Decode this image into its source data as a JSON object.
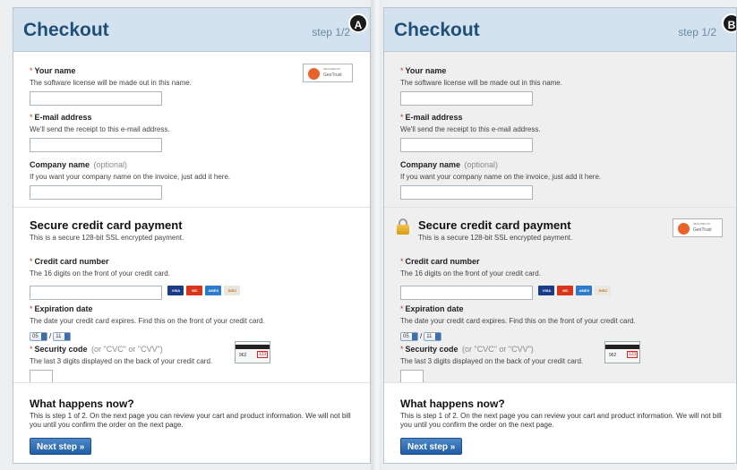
{
  "variants": [
    {
      "badge": "A",
      "header": {
        "title": "Checkout",
        "step": "step 1/2"
      },
      "name": {
        "label": "Your name",
        "hint": "The software license will be made out in this name."
      },
      "email": {
        "label": "E-mail address",
        "hint": "We'll send the receipt to this e-mail address."
      },
      "company": {
        "label": "Company name",
        "optional": "(optional)",
        "hint": "If you want your company name on the invoice, just add it here."
      },
      "payment": {
        "title": "Secure credit card payment",
        "subtitle": "This is a secure 128-bit SSL encrypted payment."
      },
      "cc": {
        "label": "Credit card number",
        "hint": "The 16 digits on the front of your credit card."
      },
      "expiry": {
        "label": "Expiration date",
        "hint": "The date your credit card expires. Find this on the front of your credit card.",
        "month": "05",
        "year": "11"
      },
      "cvc": {
        "label": "Security code",
        "optional": "(or \"CVC\" or \"CVV\")",
        "hint": "The last 3 digits displayed on the back of your credit card."
      },
      "what": {
        "title": "What happens now?",
        "text": "This is step 1 of 2. On the next page you can review your cart and product information. We will not bill you until you confirm the order on the next page."
      },
      "next_button": "Next step »"
    },
    {
      "badge": "B",
      "header": {
        "title": "Checkout",
        "step": "step 1/2"
      },
      "name": {
        "label": "Your name",
        "hint": "The software license will be made out in this name."
      },
      "email": {
        "label": "E-mail address",
        "hint": "We'll send the receipt to this e-mail address."
      },
      "company": {
        "label": "Company name",
        "optional": "(optional)",
        "hint": "If you want your company name on the invoice, just add it here."
      },
      "payment": {
        "title": "Secure credit card payment",
        "subtitle": "This is a secure 128-bit SSL encrypted payment."
      },
      "cc": {
        "label": "Credit card number",
        "hint": "The 16 digits on the front of your credit card."
      },
      "expiry": {
        "label": "Expiration date",
        "hint": "The date your credit card expires. Find this on the front of your credit card.",
        "month": "05",
        "year": "11"
      },
      "cvc": {
        "label": "Security code",
        "optional": "(or \"CVC\" or \"CVV\")",
        "hint": "The last 3 digits displayed on the back of your credit card."
      },
      "what": {
        "title": "What happens now?",
        "text": "This is step 1 of 2. On the next page you can review your cart and product information. We will not bill you until you confirm the order on the next page."
      },
      "next_button": "Next step »"
    }
  ],
  "required_marker": "*",
  "trust_seal": {
    "line1": "SECURED BY",
    "line2": "GeoTrust"
  },
  "card_brands": [
    "VISA",
    "MC",
    "AMEX",
    "DISC"
  ],
  "cvc_sample": {
    "digits": "962",
    "highlight": "123"
  },
  "colors": {
    "header_bg": "#d3e2ee",
    "title": "#1f4f79",
    "button": "#2a69b0",
    "required": "#c0392b"
  }
}
